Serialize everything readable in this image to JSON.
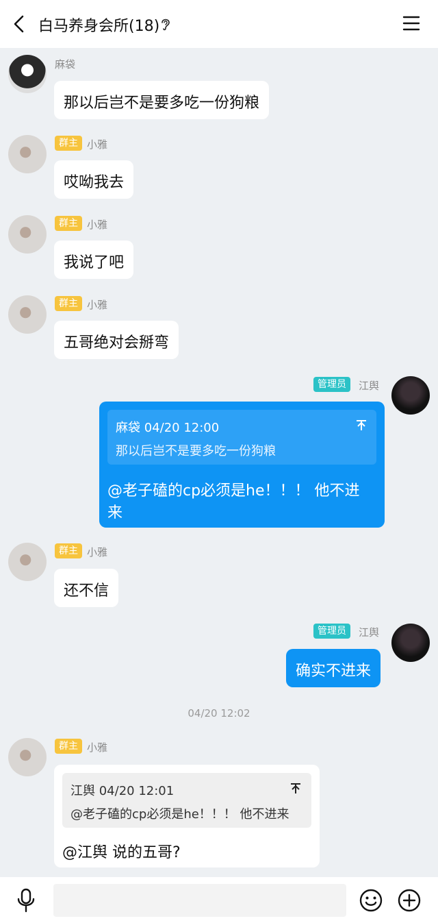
{
  "header": {
    "title": "白马养身会所(18)"
  },
  "messages": [
    {
      "sender": "麻袋",
      "text": "那以后岂不是要多吃一份狗粮"
    },
    {
      "badge": "群主",
      "sender": "小雅",
      "text": "哎呦我去"
    },
    {
      "badge": "群主",
      "sender": "小雅",
      "text": "我说了吧"
    },
    {
      "badge": "群主",
      "sender": "小雅",
      "text": "五哥绝对会掰弯"
    },
    {
      "badge": "管理员",
      "sender": "江舆",
      "quote_header": "麻袋 04/20 12:00",
      "quote_text": "那以后岂不是要多吃一份狗粮",
      "text_line1": "@老子磕的cp必须是he！！！  他不进",
      "text_line2": "来"
    },
    {
      "badge": "群主",
      "sender": "小雅",
      "text": "还不信"
    },
    {
      "badge": "管理员",
      "sender": "江舆",
      "text": "确实不进来"
    },
    {
      "badge": "群主",
      "sender": "小雅",
      "quote_header": "江舆 04/20 12:01",
      "quote_text": "@老子磕的cp必须是he！！！  他不进来",
      "text": "@江舆 说的五哥?"
    }
  ],
  "timestamp": "04/20 12:02",
  "input": {
    "placeholder": ""
  },
  "colors": {
    "self_bubble": "#0e94f4",
    "owner_badge": "#f7c43e",
    "admin_badge": "#2bc2c7",
    "background": "#edf0f3"
  },
  "icons": [
    "back-icon",
    "ear-icon",
    "menu-icon",
    "quote-arrow-icon",
    "mic-icon",
    "emoji-icon",
    "plus-icon"
  ]
}
